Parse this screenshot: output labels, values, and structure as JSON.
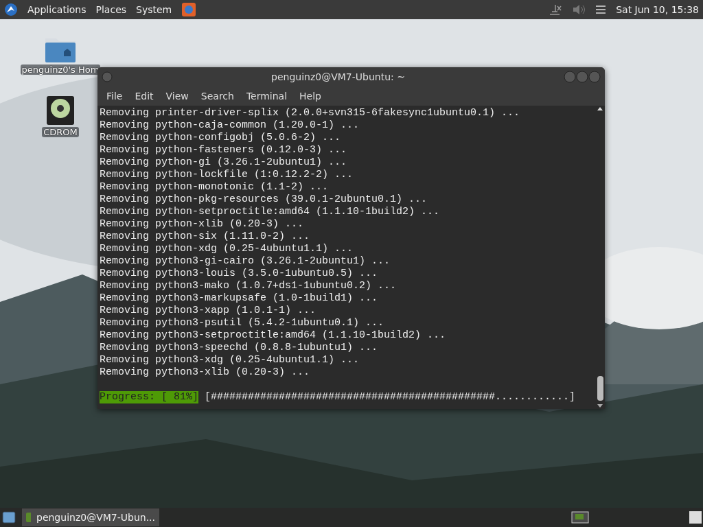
{
  "top_panel": {
    "menus": [
      "Applications",
      "Places",
      "System"
    ],
    "clock": "Sat Jun 10, 15:38"
  },
  "desktop_icons": [
    {
      "kind": "home",
      "label": "penguinz0's Hom"
    },
    {
      "kind": "cdrom",
      "label": "CDROM"
    }
  ],
  "window": {
    "title": "penguinz0@VM7-Ubuntu: ~",
    "menu": [
      "File",
      "Edit",
      "View",
      "Search",
      "Terminal",
      "Help"
    ],
    "lines": [
      "Removing printer-driver-splix (2.0.0+svn315-6fakesync1ubuntu0.1) ...",
      "Removing python-caja-common (1.20.0-1) ...",
      "Removing python-configobj (5.0.6-2) ...",
      "Removing python-fasteners (0.12.0-3) ...",
      "Removing python-gi (3.26.1-2ubuntu1) ...",
      "Removing python-lockfile (1:0.12.2-2) ...",
      "Removing python-monotonic (1.1-2) ...",
      "Removing python-pkg-resources (39.0.1-2ubuntu0.1) ...",
      "Removing python-setproctitle:amd64 (1.1.10-1build2) ...",
      "Removing python-xlib (0.20-3) ...",
      "Removing python-six (1.11.0-2) ...",
      "Removing python-xdg (0.25-4ubuntu1.1) ...",
      "Removing python3-gi-cairo (3.26.1-2ubuntu1) ...",
      "Removing python3-louis (3.5.0-1ubuntu0.5) ...",
      "Removing python3-mako (1.0.7+ds1-1ubuntu0.2) ...",
      "Removing python3-markupsafe (1.0-1build1) ...",
      "Removing python3-xapp (1.0.1-1) ...",
      "Removing python3-psutil (5.4.2-1ubuntu0.1) ...",
      "Removing python3-setproctitle:amd64 (1.1.10-1build2) ...",
      "Removing python3-speechd (0.8.8-1ubuntu1) ...",
      "Removing python3-xdg (0.25-4ubuntu1.1) ...",
      "Removing python3-xlib (0.20-3) ..."
    ],
    "progress": {
      "label": "Progress: [ 81%]",
      "bar": "[##############################################............]"
    }
  },
  "taskbar": {
    "tasks": [
      {
        "label": "penguinz0@VM7-Ubun...",
        "selected": true
      }
    ]
  }
}
